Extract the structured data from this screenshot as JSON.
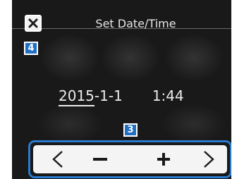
{
  "header": {
    "title": "Set Date/Time",
    "close_icon": "close-x-icon"
  },
  "callouts": {
    "close_marker": "4",
    "controls_marker": "3"
  },
  "datetime": {
    "year": "2015",
    "sep1": "- ",
    "month": "1",
    "sep2": " - ",
    "day": "1",
    "hour": "1",
    "colon": " : ",
    "minute": "44"
  },
  "controls": {
    "prev_icon": "chevron-left-icon",
    "minus_icon": "minus-icon",
    "plus_icon": "plus-icon",
    "next_icon": "chevron-right-icon"
  },
  "colors": {
    "screen_bg": "#191919",
    "callout_blue": "#1f6fc4",
    "control_border": "#2a7ad0"
  }
}
